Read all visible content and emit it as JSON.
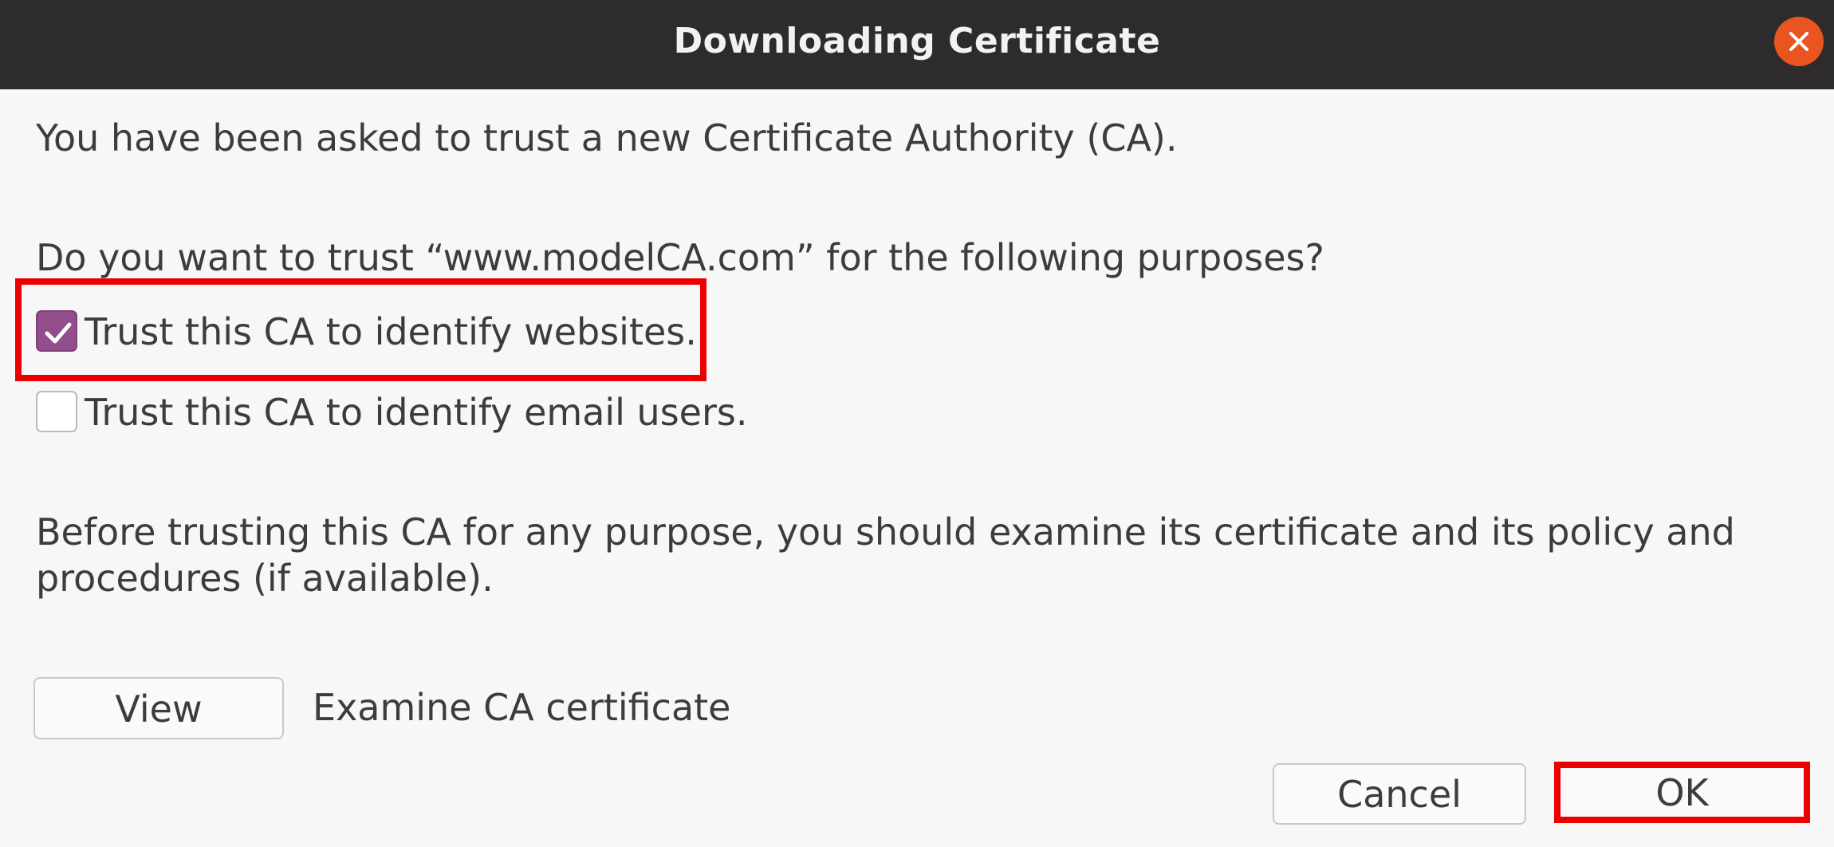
{
  "window": {
    "title": "Downloading Certificate",
    "close_icon": "close-icon",
    "accent_color": "#e95420"
  },
  "dialog": {
    "intro_text": "You have been asked to trust a new Certificate Authority (CA).",
    "question_text": "Do you want to trust “www.modelCA.com” for the following purposes?",
    "options": [
      {
        "label": "Trust this CA to identify websites.",
        "checked": true
      },
      {
        "label": "Trust this CA to identify email users.",
        "checked": false
      }
    ],
    "warning_text": "Before trusting this CA for any purpose, you should examine its certificate and its policy and procedures (if available).",
    "view_button_label": "View",
    "examine_label": "Examine CA certificate",
    "cancel_button_label": "Cancel",
    "ok_button_label": "OK",
    "checkbox_color": "#924d8b",
    "highlight_color": "#ee0000"
  }
}
